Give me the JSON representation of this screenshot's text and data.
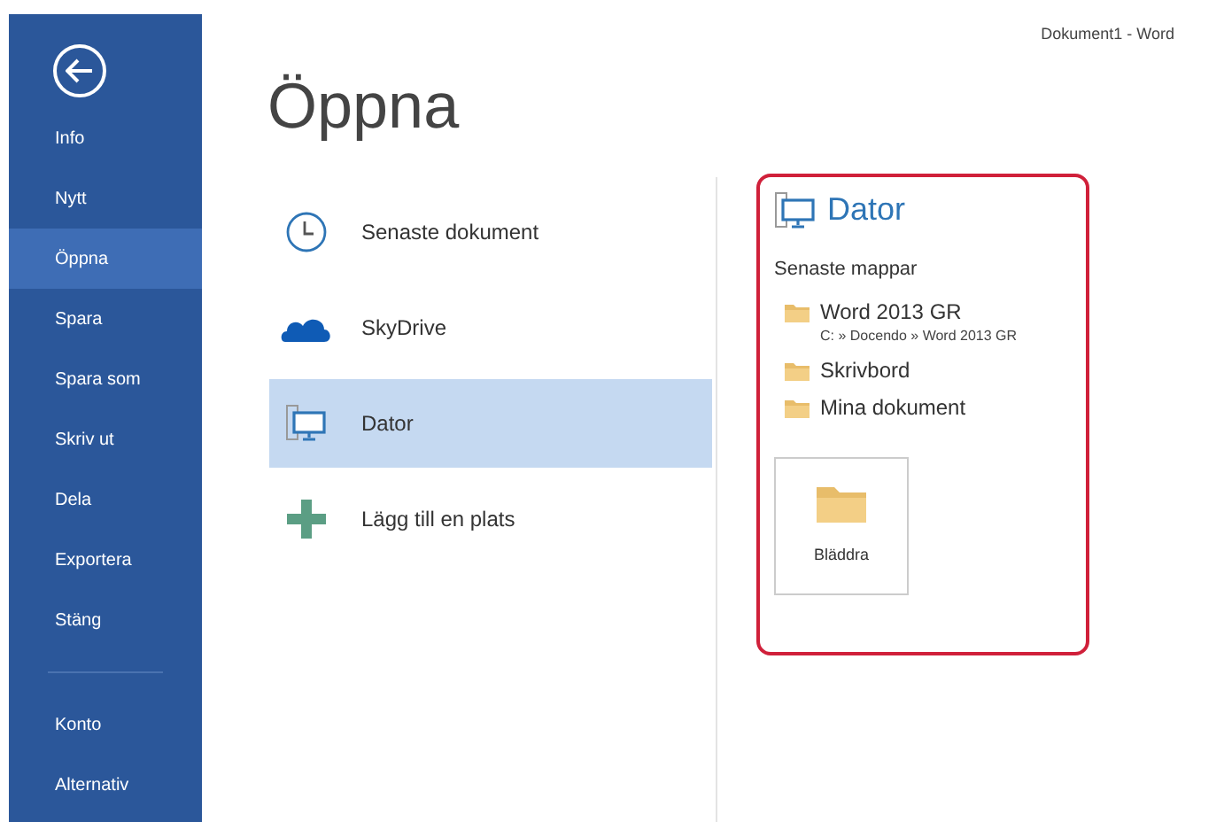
{
  "window": {
    "title": "Dokument1 - Word"
  },
  "sidebar": {
    "items": [
      {
        "label": "Info",
        "selected": false
      },
      {
        "label": "Nytt",
        "selected": false
      },
      {
        "label": "Öppna",
        "selected": true
      },
      {
        "label": "Spara",
        "selected": false
      },
      {
        "label": "Spara som",
        "selected": false
      },
      {
        "label": "Skriv ut",
        "selected": false
      },
      {
        "label": "Dela",
        "selected": false
      },
      {
        "label": "Exportera",
        "selected": false
      },
      {
        "label": "Stäng",
        "selected": false
      }
    ],
    "footer_items": [
      {
        "label": "Konto",
        "selected": false
      },
      {
        "label": "Alternativ",
        "selected": false
      }
    ]
  },
  "heading": "Öppna",
  "places": [
    {
      "kind": "recent",
      "label": "Senaste dokument",
      "selected": false
    },
    {
      "kind": "cloud",
      "label": "SkyDrive",
      "selected": false
    },
    {
      "kind": "computer",
      "label": "Dator",
      "selected": true
    },
    {
      "kind": "add",
      "label": "Lägg till en plats",
      "selected": false
    }
  ],
  "panel": {
    "title": "Dator",
    "section": "Senaste mappar",
    "folders": [
      {
        "name": "Word 2013 GR",
        "path": "C: » Docendo » Word 2013 GR"
      },
      {
        "name": "Skrivbord"
      },
      {
        "name": "Mina dokument"
      }
    ],
    "browse_button": "Bläddra"
  }
}
